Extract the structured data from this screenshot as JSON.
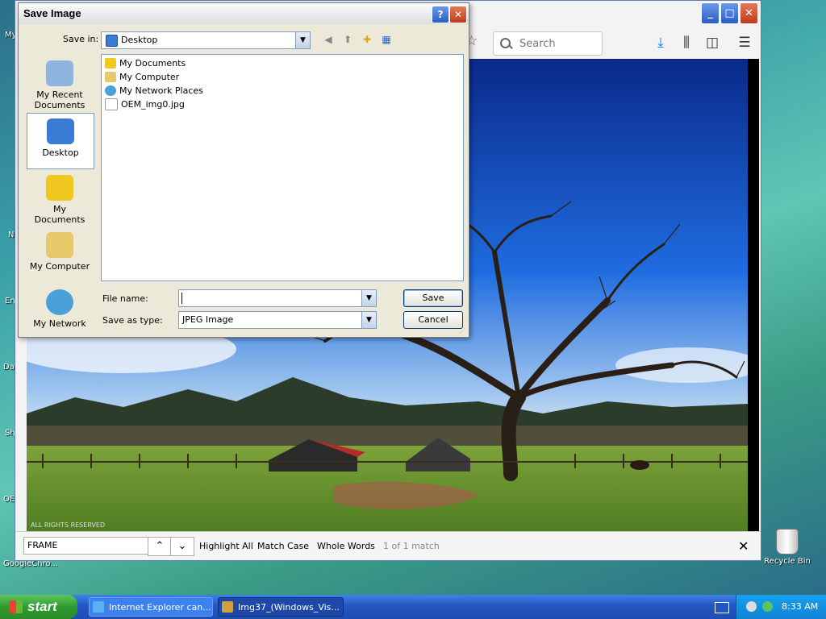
{
  "desktop": {
    "left_labels": [
      "My",
      "N",
      "En",
      "Da",
      "Sh",
      "OE"
    ],
    "recycle_bin": "Recycle Bin",
    "chrome_shortcut": "GoogleChro..."
  },
  "browser": {
    "search_placeholder": "Search",
    "icons": [
      "star-icon",
      "download-icon",
      "library-icon",
      "sidebar-icon",
      "menu-icon"
    ],
    "image_credit": "ALL RIGHTS RESERVED",
    "find": {
      "query": "FRAME",
      "highlight_all": "Highlight All",
      "match_case": "Match Case",
      "whole_words": "Whole Words",
      "status": "1 of 1 match"
    }
  },
  "dialog": {
    "title": "Save Image",
    "help": "?",
    "save_in_label": "Save in:",
    "save_in_value": "Desktop",
    "places": [
      {
        "label": "My Recent Documents",
        "icon": "recent-documents-icon"
      },
      {
        "label": "Desktop",
        "icon": "desktop-icon"
      },
      {
        "label": "My Documents",
        "icon": "my-documents-icon"
      },
      {
        "label": "My Computer",
        "icon": "my-computer-icon"
      },
      {
        "label": "My Network",
        "icon": "my-network-icon"
      }
    ],
    "files": [
      {
        "name": "My Documents",
        "icon": "folder-icon"
      },
      {
        "name": "My Computer",
        "icon": "computer-icon"
      },
      {
        "name": "My Network Places",
        "icon": "network-icon"
      },
      {
        "name": "OEM_img0.jpg",
        "icon": "jpg-file-icon"
      }
    ],
    "file_name_label": "File name:",
    "file_name_value": "",
    "save_as_type_label": "Save as type:",
    "save_as_type_value": "JPEG Image",
    "save_button": "Save",
    "cancel_button": "Cancel"
  },
  "taskbar": {
    "start": "start",
    "tasks": [
      {
        "label": "Internet Explorer can..."
      },
      {
        "label": "Img37_(Windows_Vis..."
      }
    ],
    "clock": "8:33 AM"
  },
  "colors": {
    "sky_top": "#0a2a8a",
    "sky_mid": "#1f6ce0",
    "grass": "#5e8f2a",
    "title_bar": "#2a5ec8",
    "close_red": "#c33a1c",
    "taskbar_blue": "#2456c2",
    "start_green": "#2f9b2f"
  }
}
